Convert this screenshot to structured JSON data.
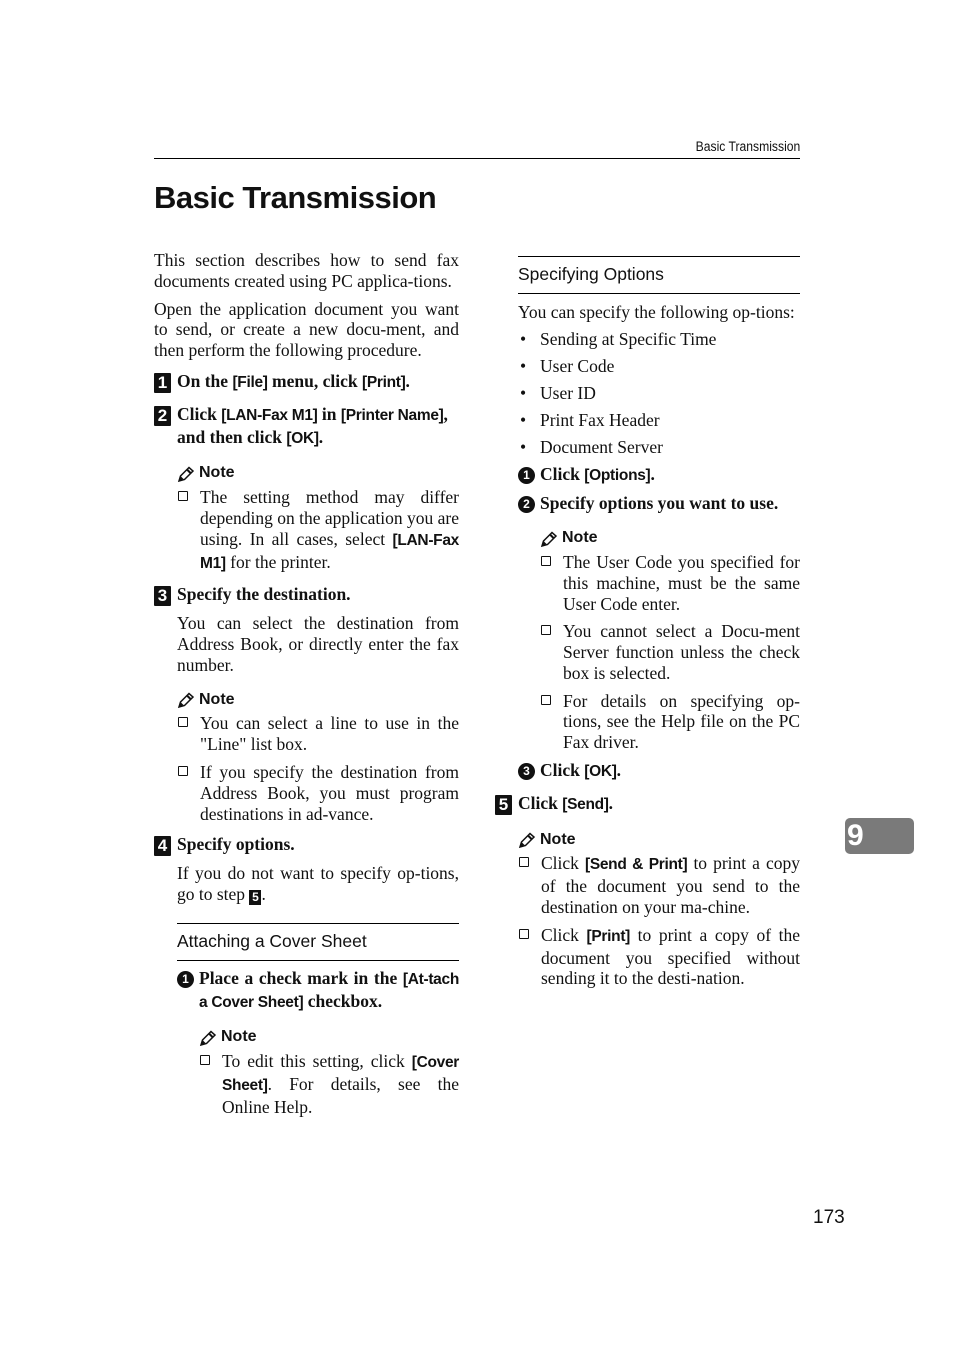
{
  "header": {
    "running_title": "Basic Transmission"
  },
  "page_title": "Basic Transmission",
  "intro": [
    "This section describes how to send fax documents created using PC applica-tions.",
    "Open the application document you want to send, or create a new docu-ment, and then perform the following procedure."
  ],
  "steps": {
    "s1": {
      "num": "1",
      "t1": "On the ",
      "u1": "[File]",
      "t2": " menu, click ",
      "u2": "[Print]",
      "t3": "."
    },
    "s2": {
      "num": "2",
      "t1": "Click ",
      "u1": "[LAN-Fax M1]",
      "t2": " in ",
      "u2": "[Printer Name]",
      "t3": ", and then click ",
      "u3": "[OK]",
      "t4": ".",
      "note_label": "Note",
      "note1_a": "The setting method may differ depending on the application you are using. In all cases, select ",
      "note1_ui": "[LAN-Fax M1]",
      "note1_b": " for the printer."
    },
    "s3": {
      "num": "3",
      "title": "Specify the destination.",
      "body": "You can select the destination from Address Book, or directly enter the fax number.",
      "note_label": "Note",
      "notes": [
        "You can select a line to use in the \"Line\" list box.",
        "If you specify the destination from Address Book, you must program destinations in ad-vance."
      ]
    },
    "s4": {
      "num": "4",
      "title": "Specify options.",
      "body_a": "If you do not want to specify op-tions, go to step ",
      "body_ref": "5",
      "body_b": ".",
      "cover_section": {
        "heading": "Attaching a Cover Sheet",
        "sub1_num": "1",
        "sub1_a": "Place a check mark in the ",
        "sub1_ui": "[At-tach a Cover Sheet]",
        "sub1_b": " checkbox.",
        "note_label": "Note",
        "note_a": "To edit this setting, click ",
        "note_ui": "[Cover Sheet]",
        "note_b": ". For details, see the Online Help."
      }
    },
    "options_section": {
      "heading": "Specifying Options",
      "intro": "You can specify the following op-tions:",
      "options": [
        "Sending at Specific Time",
        "User Code",
        "User ID",
        "Print Fax Header",
        "Document Server"
      ],
      "sub1_num": "1",
      "sub1_a": "Click ",
      "sub1_ui": "[Options]",
      "sub1_b": ".",
      "sub2_num": "2",
      "sub2": "Specify options you want to use.",
      "note_label": "Note",
      "notes": [
        "The User Code you specified for this machine, must be the same User Code enter.",
        "You cannot select a Docu-ment Server function unless the check box is selected.",
        "For details on specifying op-tions, see the Help file on the PC Fax driver."
      ],
      "sub3_num": "3",
      "sub3_a": "Click ",
      "sub3_ui": "[OK]",
      "sub3_b": "."
    },
    "s5": {
      "num": "5",
      "t1": "Click ",
      "u1": "[Send]",
      "t2": ".",
      "note_label": "Note",
      "note1_a": "Click ",
      "note1_ui": "[Send & Print]",
      "note1_b": " to print a copy of the document you send to the destination on your ma-chine.",
      "note2_a": "Click ",
      "note2_ui": "[Print]",
      "note2_b": " to print a copy of the document you specified without sending it to the desti-nation."
    }
  },
  "chapter_tab": {
    "label": "9",
    "color": "#7a7a7a"
  },
  "page_number": "173"
}
